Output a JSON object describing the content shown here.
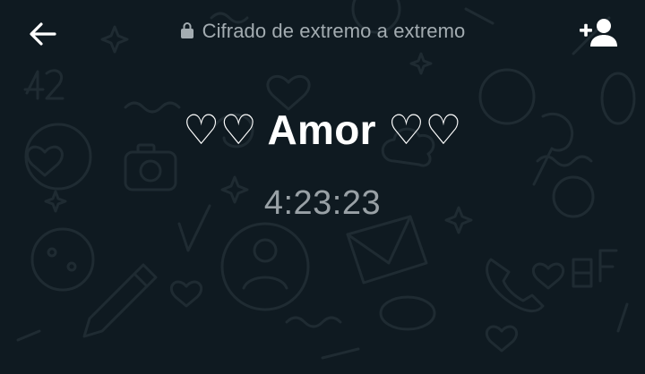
{
  "header": {
    "back_icon": "arrow-left-icon",
    "encryption_icon": "lock-icon",
    "encryption_text": "Cifrado de extremo a extremo",
    "add_participant_icon": "add-person-icon"
  },
  "call": {
    "title": "♡♡ Amor ♡♡",
    "duration": "4:23:23"
  },
  "colors": {
    "background": "#0f1a21",
    "doodle": "#1f2b32",
    "title": "#ffffff",
    "secondary_text": "#a3acb1"
  }
}
